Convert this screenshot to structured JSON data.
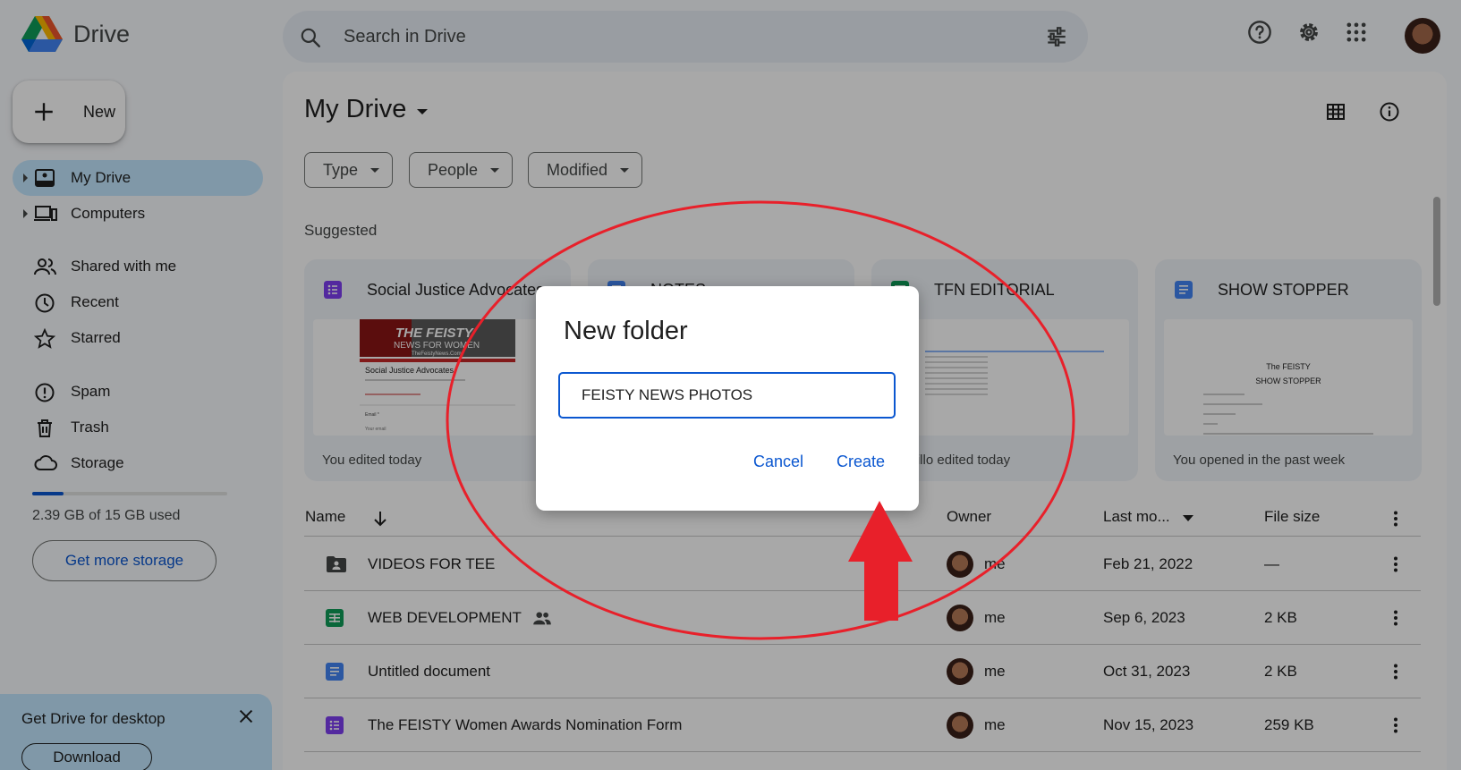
{
  "header": {
    "app_name": "Drive",
    "search_placeholder": "Search in Drive"
  },
  "sidebar": {
    "new_label": "New",
    "items": [
      {
        "label": "My Drive",
        "active": true
      },
      {
        "label": "Computers"
      },
      {
        "label": "Shared with me"
      },
      {
        "label": "Recent"
      },
      {
        "label": "Starred"
      },
      {
        "label": "Spam"
      },
      {
        "label": "Trash"
      },
      {
        "label": "Storage"
      }
    ],
    "storage_used_fraction": 0.16,
    "storage_text": "2.39 GB of 15 GB used",
    "get_storage_label": "Get more storage",
    "promo_title": "Get Drive for desktop",
    "promo_download": "Download"
  },
  "main": {
    "title": "My Drive",
    "filters": [
      "Type",
      "People",
      "Modified"
    ],
    "suggested_label": "Suggested",
    "cards": [
      {
        "name": "Social Justice Advocates",
        "footer": "You edited today",
        "type": "form",
        "thumb_header": "THE FEISTY",
        "thumb_sub": "NEWS FOR WOMEN",
        "thumb_site": "TheFeistyNews.Com",
        "thumb_title": "Social Justice Advocates",
        "thumb_field": "Email *",
        "thumb_placeholder": "Your email"
      },
      {
        "name": "NOTES",
        "footer": "",
        "type": "doc"
      },
      {
        "name": "TFN EDITORIAL",
        "footer": "Castillo edited today",
        "type": "sheet"
      },
      {
        "name": "SHOW STOPPER",
        "footer": "You opened in the past week",
        "type": "doc",
        "thumb_line1": "The FEISTY",
        "thumb_line2": "SHOW STOPPER"
      }
    ],
    "columns": {
      "name": "Name",
      "owner": "Owner",
      "modified": "Last mo...",
      "size": "File size"
    },
    "rows": [
      {
        "name": "VIDEOS FOR TEE",
        "type": "shared-folder",
        "owner": "me",
        "date": "Feb 21, 2022",
        "size": "—",
        "shared": false
      },
      {
        "name": "WEB DEVELOPMENT",
        "type": "sheet",
        "owner": "me",
        "date": "Sep 6, 2023",
        "size": "2 KB",
        "shared": true
      },
      {
        "name": "Untitled document",
        "type": "doc",
        "owner": "me",
        "date": "Oct 31, 2023",
        "size": "2 KB",
        "shared": false
      },
      {
        "name": "The FEISTY Women Awards Nomination Form",
        "type": "form",
        "owner": "me",
        "date": "Nov 15, 2023",
        "size": "259 KB",
        "shared": false
      }
    ]
  },
  "dialog": {
    "title": "New folder",
    "input_value": "FEISTY NEWS PHOTOS",
    "cancel_label": "Cancel",
    "create_label": "Create"
  },
  "colors": {
    "accent": "#0b57d0",
    "nav_active": "#c2e7ff",
    "annotation": "#e8202a",
    "form_icon": "#7e3ff2",
    "doc_icon": "#4285f4",
    "sheet_icon": "#0f9d58"
  }
}
